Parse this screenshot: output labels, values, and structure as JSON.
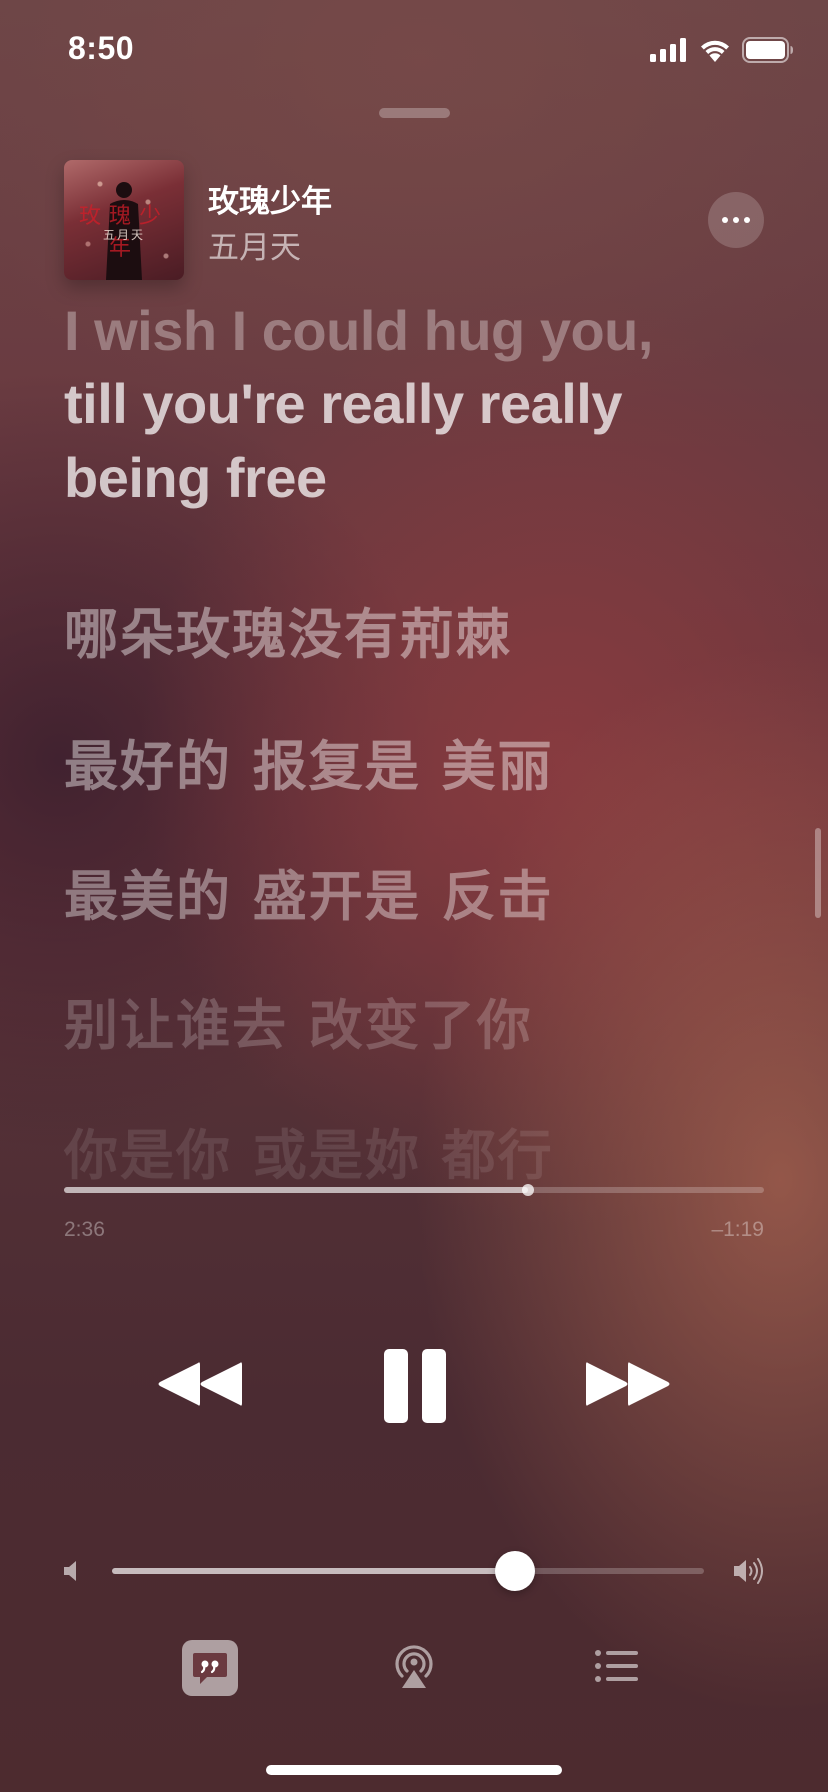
{
  "status_bar": {
    "time": "8:50"
  },
  "now_playing": {
    "song_title": "玫瑰少年",
    "artist": "五月天",
    "artwork": {
      "title_text": "玫瑰少年",
      "artist_text": "五月天"
    }
  },
  "lyrics": [
    {
      "text": "I wish I could hug you,",
      "lang": "en",
      "state": "past",
      "opacity": 0.32
    },
    {
      "text": "till you're really really",
      "lang": "en",
      "state": "current",
      "opacity": 0.72
    },
    {
      "text": "being free",
      "lang": "en",
      "state": "current",
      "opacity": 0.72
    },
    {
      "text": "哪朵玫瑰没有荊棘",
      "lang": "zh",
      "state": "upcoming",
      "opacity": 0.42
    },
    {
      "text": "最好的 报复是 美丽",
      "lang": "zh",
      "state": "upcoming",
      "opacity": 0.42
    },
    {
      "text": "最美的 盛开是 反击",
      "lang": "zh",
      "state": "upcoming",
      "opacity": 0.38
    },
    {
      "text": "别让谁去 改变了你",
      "lang": "zh",
      "state": "upcoming",
      "opacity": 0.2
    },
    {
      "text": "你是你 或是妳 都行",
      "lang": "zh",
      "state": "upcoming",
      "opacity": 0.1
    }
  ],
  "playback": {
    "elapsed": "2:36",
    "remaining": "–1:19",
    "progress": 0.663
  },
  "volume": {
    "level": 0.68
  },
  "icons": {
    "more": "ellipsis-icon",
    "rewind": "rewind-icon",
    "pause": "pause-icon",
    "forward": "fast-forward-icon",
    "volume_low": "speaker-icon",
    "volume_high": "speaker-wave-icon",
    "lyrics": "quote-bubble-icon",
    "airplay": "airplay-audio-icon",
    "queue": "list-icon"
  },
  "colors": {
    "lyrics_active_button": "#ffffff",
    "text_primary": "#ffffff"
  }
}
